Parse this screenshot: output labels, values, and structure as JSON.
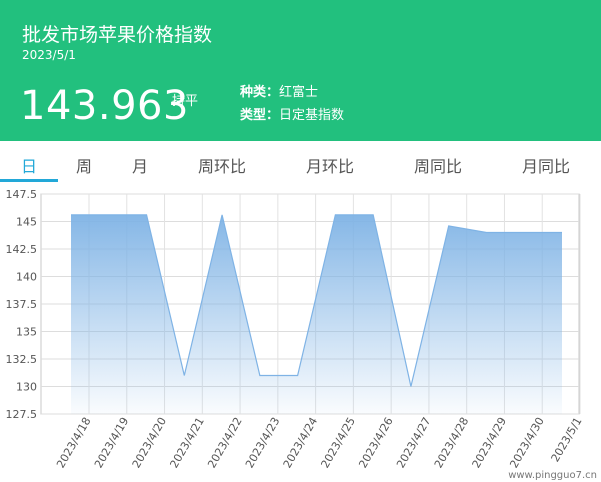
{
  "header": {
    "title": "批发市场苹果价格指数",
    "date": "2023/5/1",
    "price": "143.963",
    "trend": "持平",
    "variety_label": "种类：",
    "variety_value": "红富士",
    "type_label": "类型：",
    "type_value": "日定基指数"
  },
  "tabs": [
    {
      "label": "日",
      "active": true
    },
    {
      "label": "周",
      "active": false
    },
    {
      "label": "月",
      "active": false
    },
    {
      "label": "周环比",
      "active": false
    },
    {
      "label": "月环比",
      "active": false
    },
    {
      "label": "周同比",
      "active": false
    },
    {
      "label": "月同比",
      "active": false
    }
  ],
  "watermark": "www.pingguo7.cn",
  "colors": {
    "header_bg": "#22c07e",
    "accent": "#22a8d8",
    "line": "#7fb3e5",
    "fill_top": "#7fb3e5"
  },
  "chart_data": {
    "type": "area",
    "categories": [
      "2023/4/18",
      "2023/4/19",
      "2023/4/20",
      "2023/4/21",
      "2023/4/22",
      "2023/4/23",
      "2023/4/24",
      "2023/4/25",
      "2023/4/26",
      "2023/4/27",
      "2023/4/28",
      "2023/4/29",
      "2023/4/30",
      "2023/5/1"
    ],
    "values": [
      145.6,
      145.6,
      145.6,
      131.0,
      145.6,
      131.0,
      131.0,
      145.6,
      145.6,
      130.0,
      144.6,
      144.0,
      144.0,
      144.0
    ],
    "yticks": [
      "147.5",
      "145",
      "142.5",
      "140",
      "137.5",
      "135",
      "132.5",
      "130",
      "127.5"
    ],
    "ylim": [
      127.5,
      147.5
    ],
    "grid": true,
    "legend": "none"
  }
}
